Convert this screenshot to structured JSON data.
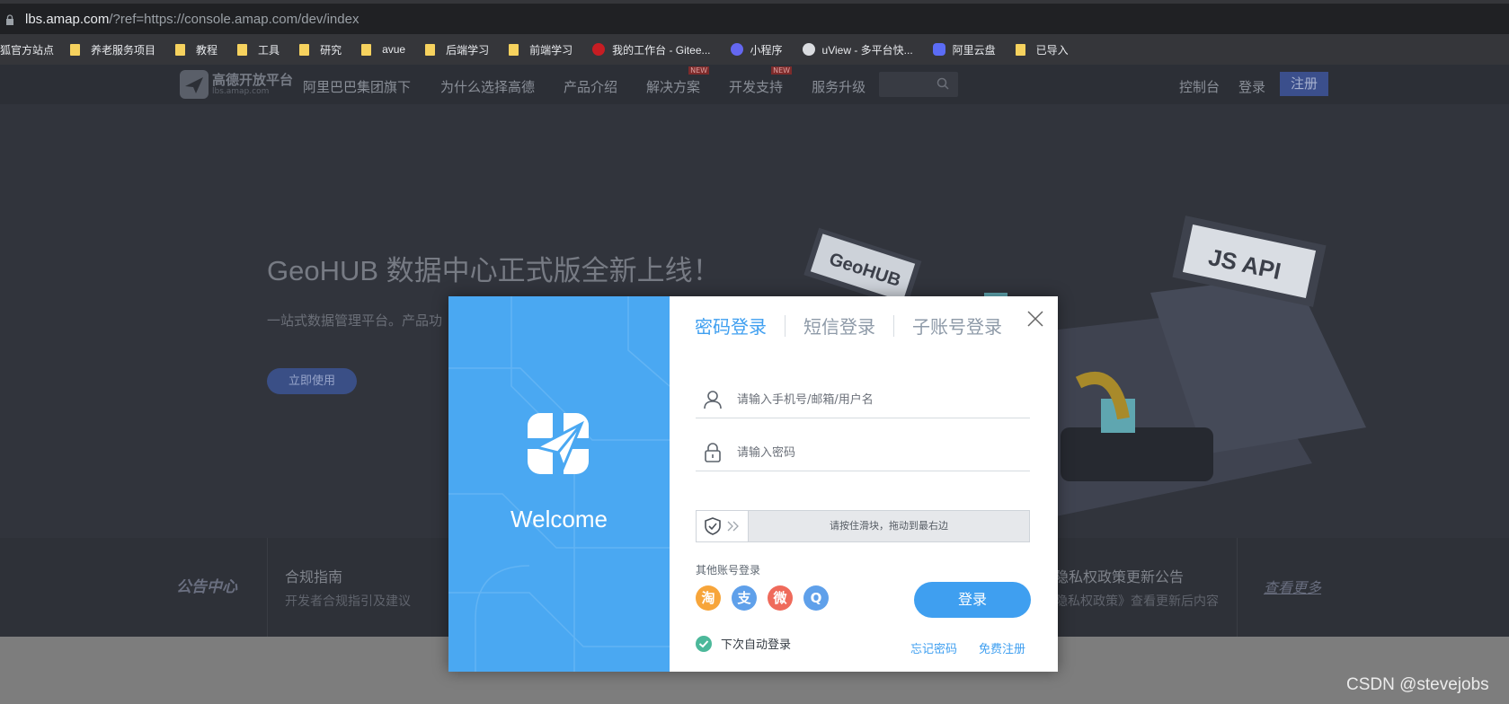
{
  "browser": {
    "url_host": "lbs.amap.com",
    "url_rest": "/?ref=https://console.amap.com/dev/index",
    "bookmarks": [
      {
        "label": "狐官方站点",
        "icon": "none"
      },
      {
        "label": "养老服务项目",
        "icon": "folder-icon"
      },
      {
        "label": "教程",
        "icon": "folder-icon"
      },
      {
        "label": "工具",
        "icon": "folder-icon"
      },
      {
        "label": "研究",
        "icon": "folder-icon"
      },
      {
        "label": "avue",
        "icon": "folder-icon"
      },
      {
        "label": "后端学习",
        "icon": "folder-icon"
      },
      {
        "label": "前端学习",
        "icon": "folder-icon"
      },
      {
        "label": "我的工作台 - Gitee...",
        "icon": "gitee-icon"
      },
      {
        "label": "小程序",
        "icon": "miniprogram-icon"
      },
      {
        "label": "uView - 多平台快...",
        "icon": "globe-icon"
      },
      {
        "label": "阿里云盘",
        "icon": "aliyun-drive-icon"
      },
      {
        "label": "已导入",
        "icon": "folder-icon"
      }
    ]
  },
  "site": {
    "logo_text": "高德开放平台",
    "logo_sub": "lbs.amap.com",
    "brand_sub": "阿里巴巴集团旗下",
    "nav": [
      {
        "label": "为什么选择高德",
        "new": ""
      },
      {
        "label": "产品介绍",
        "new": ""
      },
      {
        "label": "解决方案",
        "new": "NEW"
      },
      {
        "label": "开发支持",
        "new": "NEW"
      },
      {
        "label": "服务升级",
        "new": ""
      }
    ],
    "console": "控制台",
    "login": "登录",
    "register": "注册",
    "hero_title": "GeoHUB 数据中心正式版全新上线！",
    "hero_sub": "一站式数据管理平台。产品功",
    "hero_button": "立即使用",
    "hero_signs": [
      "GeoHUB",
      "JS API"
    ],
    "notice_logo": "公告中心",
    "notice_items": [
      {
        "title": "合规指南",
        "desc": "开发者合规指引及建议"
      },
      {
        "title": "隐私权政策更新公告",
        "desc": "《隐私权政策》查看更新后内容"
      }
    ],
    "notice_more": "查看更多"
  },
  "modal": {
    "welcome": "Welcome",
    "tabs": [
      "密码登录",
      "短信登录",
      "子账号登录"
    ],
    "username_placeholder": "请输入手机号/邮箱/用户名",
    "password_placeholder": "请输入密码",
    "slider_text": "请按住滑块，拖动到最右边",
    "other_login_label": "其他账号登录",
    "social": [
      {
        "name": "taobao",
        "glyph": "淘",
        "color": "#f7a53a"
      },
      {
        "name": "alipay",
        "glyph": "支",
        "color": "#5fa0ea"
      },
      {
        "name": "weibo",
        "glyph": "微",
        "color": "#ef6a5b"
      },
      {
        "name": "qq",
        "glyph": "Q",
        "color": "#5fa0ea"
      }
    ],
    "login_button": "登录",
    "auto_login": "下次自动登录",
    "forgot_password": "忘记密码",
    "free_register": "免费注册"
  },
  "watermark": "CSDN @stevejobs"
}
